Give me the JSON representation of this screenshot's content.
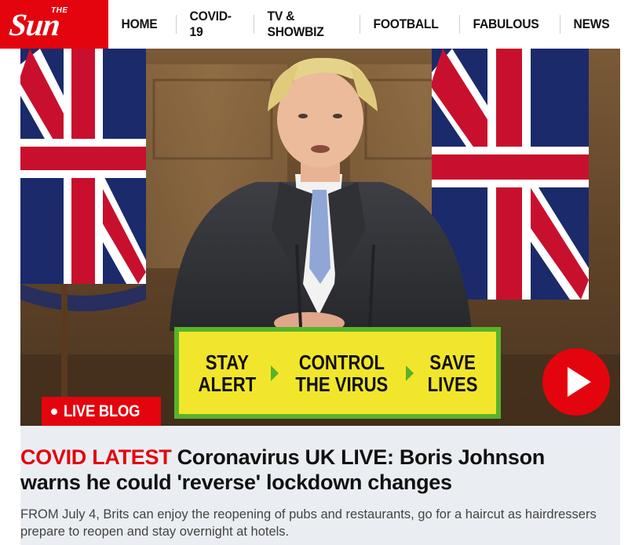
{
  "brand": {
    "the": "THE",
    "name": "Sun",
    "color": "#e4040e"
  },
  "nav": {
    "items": [
      {
        "label": "HOME"
      },
      {
        "label": "COVID-19"
      },
      {
        "label": "TV & SHOWBIZ"
      },
      {
        "label": "FOOTBALL"
      },
      {
        "label": "FABULOUS"
      },
      {
        "label": "NEWS"
      }
    ]
  },
  "hero": {
    "sign": {
      "left": "STAY ALERT",
      "middle": "CONTROL THE VIRUS",
      "right": "SAVE LIVES",
      "colors": {
        "background": "#f2e62c",
        "border": "#58b32a"
      }
    },
    "play_icon": "play-icon",
    "badge": "LIVE BLOG"
  },
  "article": {
    "kicker": "COVID LATEST",
    "headline": "Coronavirus UK LIVE: Boris Johnson warns he could 'reverse' lockdown changes",
    "standfirst": "FROM July 4, Brits can enjoy the reopening of pubs and restaurants, go for a haircut as hairdressers prepare to reopen and stay overnight at hotels."
  }
}
